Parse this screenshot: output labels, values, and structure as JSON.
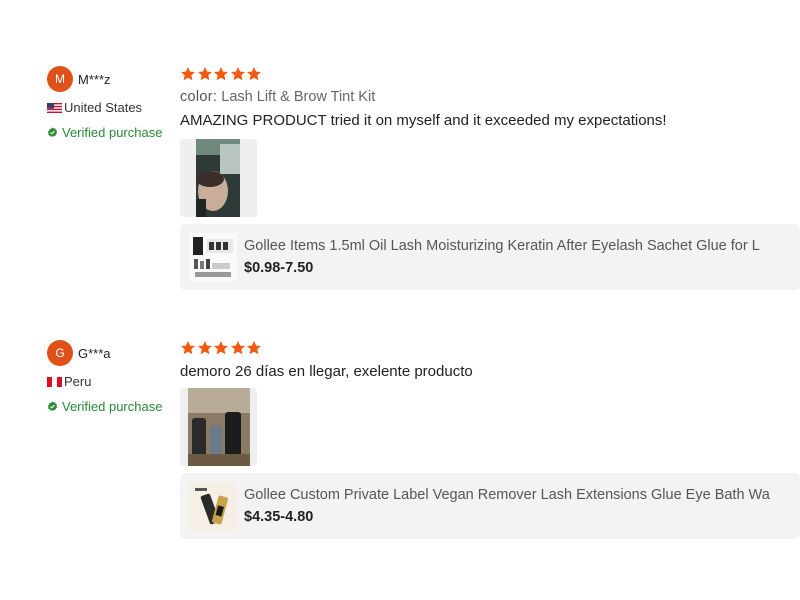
{
  "reviews": [
    {
      "avatar_letter": "M",
      "username": "M***z",
      "country": "United States",
      "verified": "Verified purchase",
      "rating": 5,
      "color_label": "color:",
      "color_value": "Lash Lift & Brow Tint Kit",
      "text": "AMAZING PRODUCT tried it on myself and it exceeded my expectations!",
      "product_title": "Gollee Items 1.5ml Oil Lash Moisturizing Keratin After Eyelash Sachet Glue for L",
      "product_price": "$0.98-7.50"
    },
    {
      "avatar_letter": "G",
      "username": "G***a",
      "country": "Peru",
      "verified": "Verified purchase",
      "rating": 5,
      "text": "demoro 26 días en llegar, exelente producto",
      "product_title": "Gollee Custom Private Label Vegan Remover Lash Extensions Glue Eye Bath Wa",
      "product_price": "$4.35-4.80"
    }
  ],
  "colors": {
    "star": "#f25a0f",
    "avatar": "#e0501a",
    "verified": "#2a8a37",
    "card_bg": "#f3f3f3"
  },
  "icons": [
    "star-icon",
    "us-flag-icon",
    "peru-flag-icon",
    "verified-check-icon"
  ]
}
